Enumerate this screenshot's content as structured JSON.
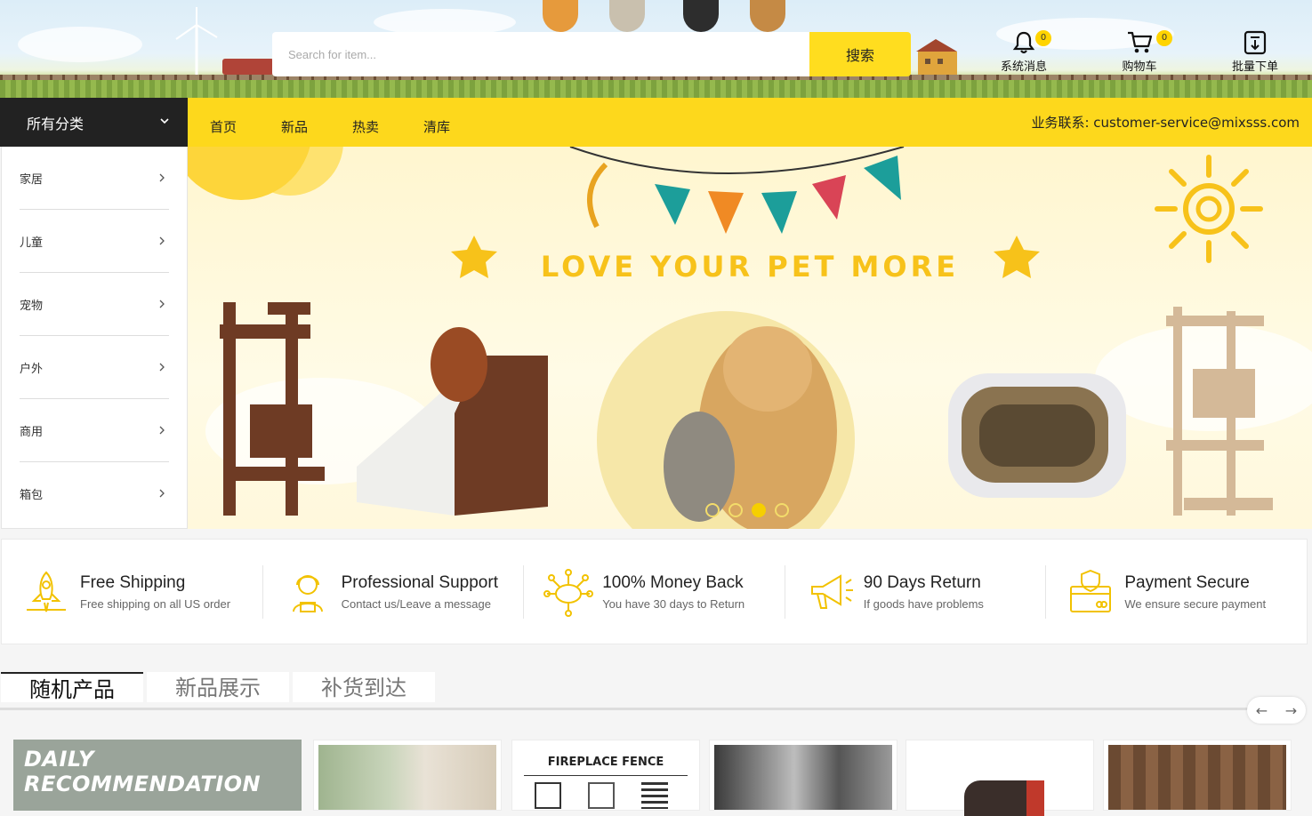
{
  "header": {
    "search_placeholder": "Search for item...",
    "search_button": "搜索",
    "notifications_label": "系统消息",
    "notifications_count": "0",
    "cart_label": "购物车",
    "cart_count": "0",
    "bulk_order_label": "批量下单"
  },
  "nav": {
    "all_categories": "所有分类",
    "links": [
      "首页",
      "新品",
      "热卖",
      "清库"
    ],
    "contact_label": "业务联系: customer-service@mixsss.com"
  },
  "categories": [
    "家居",
    "儿童",
    "宠物",
    "户外",
    "商用",
    "箱包"
  ],
  "hero": {
    "headline": "LOVE YOUR PET MORE",
    "slides": 4,
    "active_slide": 3
  },
  "features": [
    {
      "icon": "rocket-icon",
      "title": "Free Shipping",
      "subtitle": "Free shipping on all US order"
    },
    {
      "icon": "support-agent-icon",
      "title": "Professional Support",
      "subtitle": "Contact us/Leave a message"
    },
    {
      "icon": "piggy-bank-icon",
      "title": "100% Money Back",
      "subtitle": "You have 30 days to Return"
    },
    {
      "icon": "megaphone-icon",
      "title": "90 Days Return",
      "subtitle": "If goods have problems"
    },
    {
      "icon": "secure-card-icon",
      "title": "Payment Secure",
      "subtitle": "We ensure secure payment"
    }
  ],
  "tabs": [
    "随机产品",
    "新品展示",
    "补货到达"
  ],
  "carousel_arrows": {
    "prev": "←",
    "next": "→"
  },
  "products": {
    "daily_banner": "DAILY RECOMMENDATION",
    "fence_title": "FIREPLACE FENCE"
  },
  "colors": {
    "brand_yellow": "#fdd81c",
    "dark": "#222222",
    "icon_yellow": "#f2c200"
  }
}
